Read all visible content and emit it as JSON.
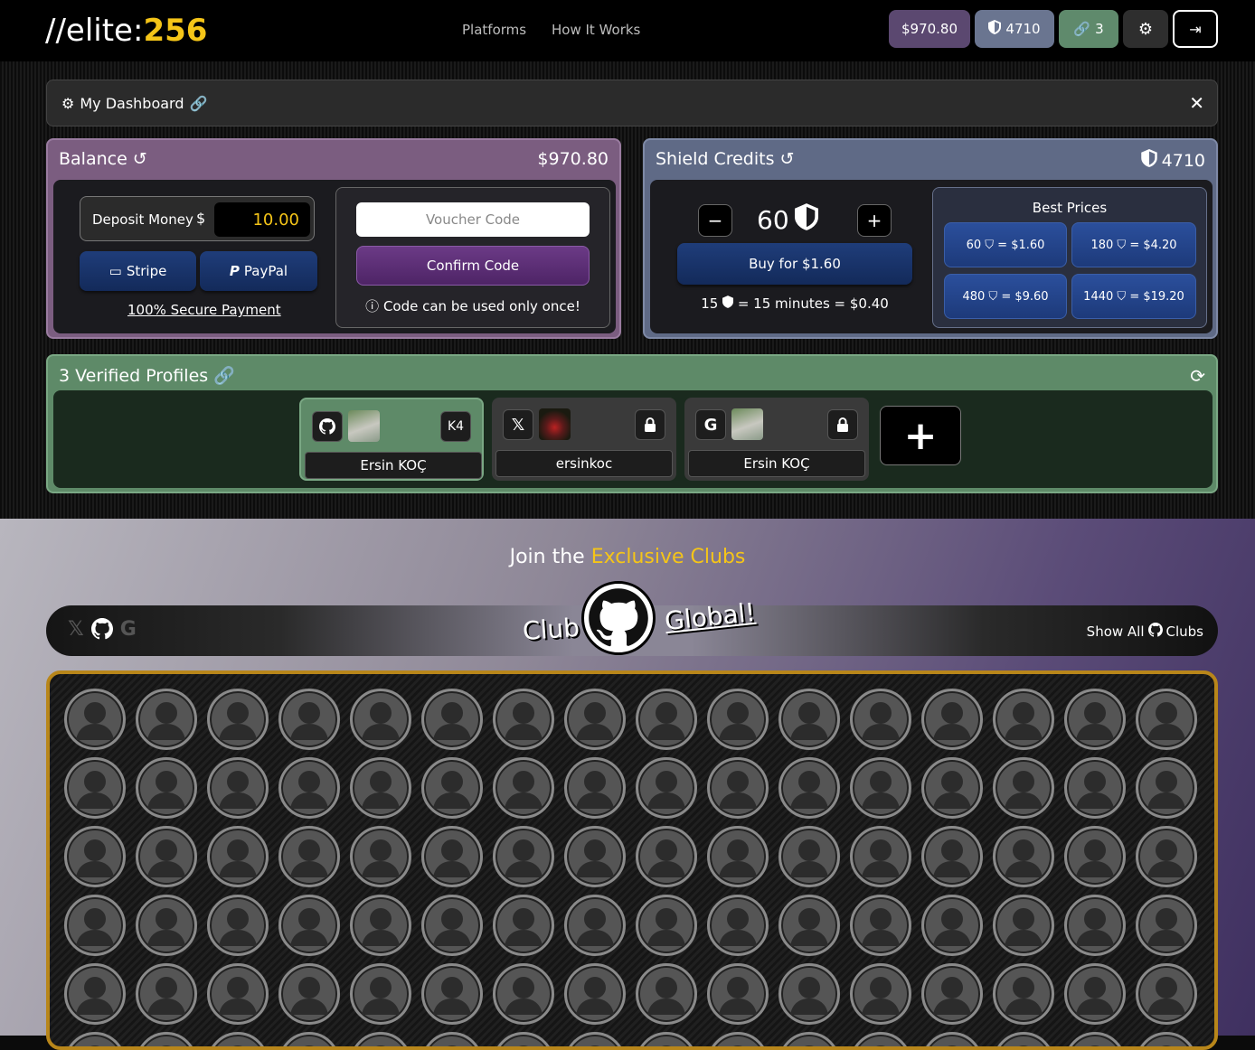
{
  "header": {
    "logo_prefix": "//elite:",
    "logo_number": "256",
    "nav": [
      "Platforms",
      "How It Works"
    ],
    "balance_pill": "$970.80",
    "shield_pill": "4710",
    "links_pill": "3"
  },
  "dashboard": {
    "title": "My Dashboard"
  },
  "balance": {
    "title": "Balance",
    "amount": "$970.80",
    "deposit_label": "Deposit Money",
    "deposit_value": "10.00",
    "stripe_label": "Stripe",
    "paypal_label": "PayPal",
    "secure_label": "100% Secure Payment",
    "voucher_placeholder": "Voucher Code",
    "confirm_label": "Confirm Code",
    "voucher_note": "Code can be used only once!"
  },
  "shield": {
    "title": "Shield Credits",
    "amount": "4710",
    "quantity": "60",
    "minus": "−",
    "plus": "+",
    "buy_label": "Buy for $1.60",
    "rate_left": "15",
    "rate_right": "= 15 minutes = $0.40",
    "best_prices_title": "Best Prices",
    "prices": [
      {
        "qty": "60",
        "price": "= $1.60"
      },
      {
        "qty": "180",
        "price": "= $4.20"
      },
      {
        "qty": "480",
        "price": "= $9.60"
      },
      {
        "qty": "1440",
        "price": "= $19.20"
      }
    ]
  },
  "profiles": {
    "title": "3 Verified Profiles",
    "items": [
      {
        "platform": "github",
        "name": "Ersin KOÇ",
        "badge": "K4"
      },
      {
        "platform": "x",
        "name": "ersinkoc",
        "badge": ""
      },
      {
        "platform": "google",
        "name": "Ersin KOÇ",
        "badge": ""
      }
    ]
  },
  "clubs": {
    "heading_prefix": "Join the ",
    "heading_highlight": "Exclusive Clubs",
    "club_word": "Club",
    "club_name": "Global!",
    "show_all_prefix": "Show All",
    "show_all_suffix": "Clubs"
  },
  "colors": {
    "accent_gold": "#f5c518",
    "balance_purple": "#7b5d80",
    "shield_slate": "#5f6a86",
    "profiles_green": "#5e8a68",
    "grid_border": "#b8861a"
  }
}
